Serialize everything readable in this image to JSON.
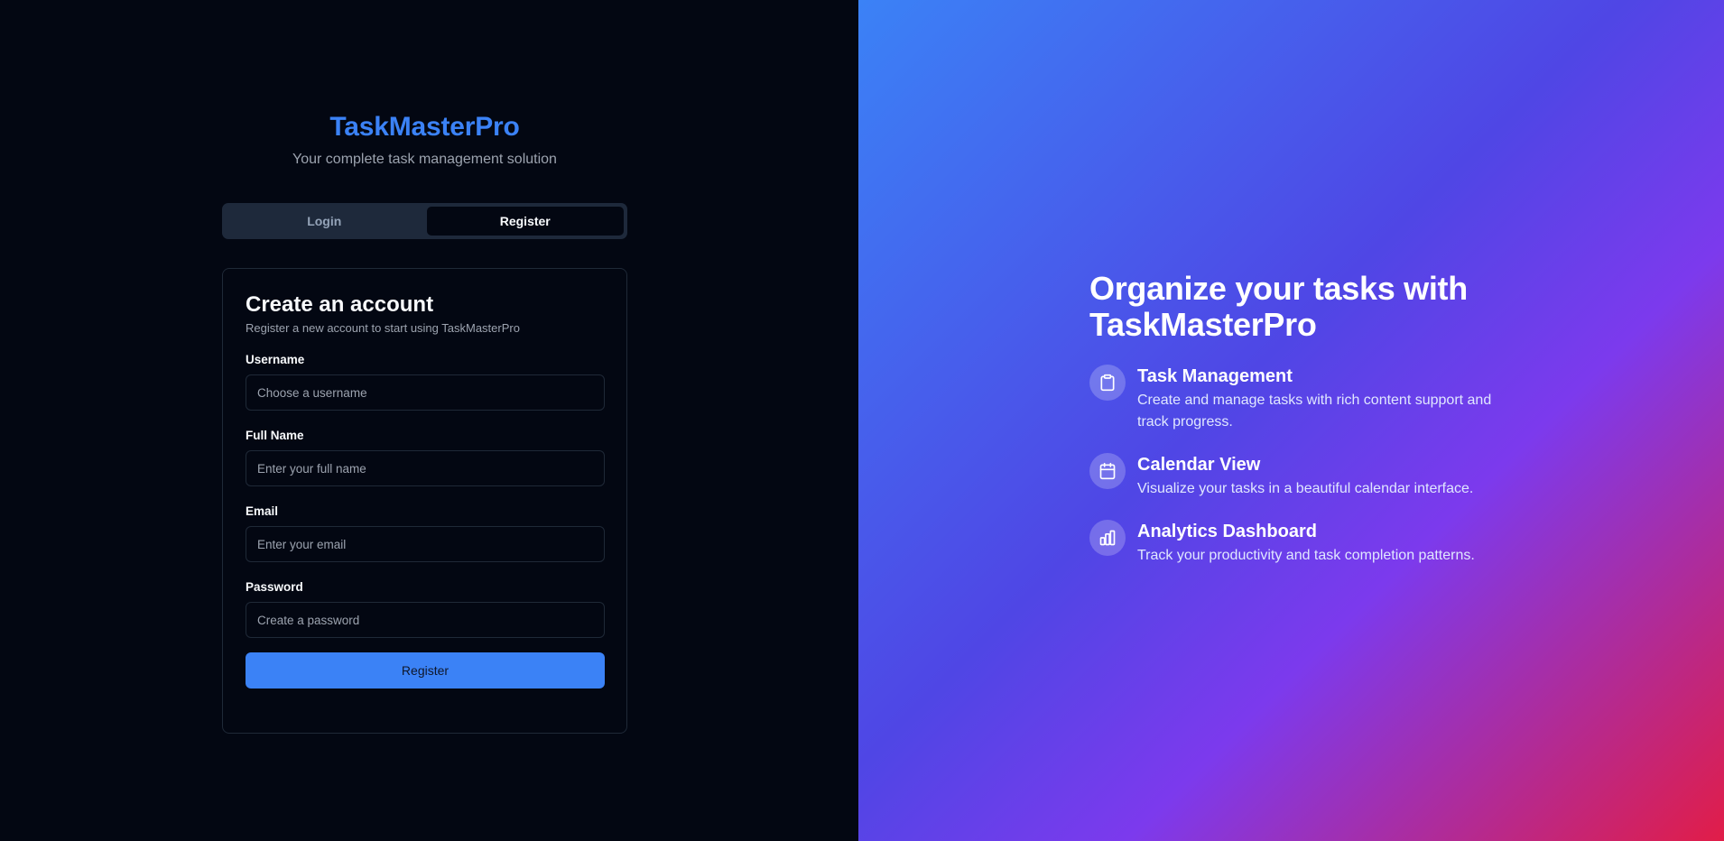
{
  "brand": {
    "title": "TaskMasterPro",
    "subtitle": "Your complete task management solution",
    "color": "#3b82f6"
  },
  "tabs": [
    {
      "label": "Login",
      "active": false
    },
    {
      "label": "Register",
      "active": true
    }
  ],
  "register_card": {
    "title": "Create an account",
    "description": "Register a new account to start using TaskMasterPro",
    "fields": {
      "username": {
        "label": "Username",
        "placeholder": "Choose a username",
        "value": ""
      },
      "full_name": {
        "label": "Full Name",
        "placeholder": "Enter your full name",
        "value": ""
      },
      "email": {
        "label": "Email",
        "placeholder": "Enter your email",
        "value": ""
      },
      "password": {
        "label": "Password",
        "placeholder": "Create a password",
        "value": ""
      }
    },
    "submit_label": "Register"
  },
  "promo": {
    "title": "Organize your tasks with TaskMasterPro",
    "features": [
      {
        "icon": "clipboard-icon",
        "title": "Task Management",
        "description": "Create and manage tasks with rich content support and track progress."
      },
      {
        "icon": "calendar-icon",
        "title": "Calendar View",
        "description": "Visualize your tasks in a beautiful calendar interface."
      },
      {
        "icon": "bar-chart-icon",
        "title": "Analytics Dashboard",
        "description": "Track your productivity and task completion patterns."
      }
    ]
  },
  "colors": {
    "background": "#030712",
    "accent": "#3b82f6",
    "gradient_start": "#3b82f6",
    "gradient_mid": "#4f46e5",
    "gradient_end": "#e11d48"
  }
}
